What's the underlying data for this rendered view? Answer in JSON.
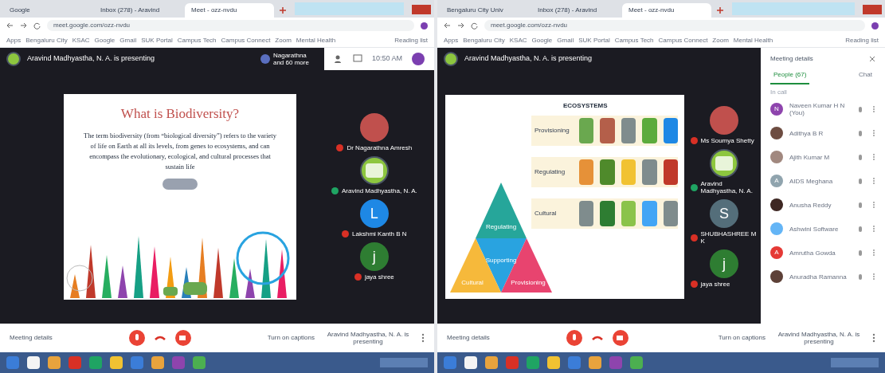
{
  "windows": [
    {
      "tabs": [
        {
          "label": "Google",
          "selected": false
        },
        {
          "label": "Inbox (278) - Aravind",
          "selected": false
        },
        {
          "label": "Meet - ozz-nvdu",
          "selected": true
        }
      ],
      "address": "meet.google.com/ozz-nvdu",
      "bookmarks": [
        "Apps",
        "Bengaluru City",
        "KSAC",
        "Google",
        "Gmail",
        "SUK Portal",
        "Campus Tech",
        "Campus Connect",
        "Zoom",
        "Mental Health"
      ],
      "reading_list": "Reading list",
      "presenting": "Aravind Madhyastha, N. A. is presenting",
      "presenter_chip": "Nagarathna and 60 more",
      "time": "10:50 AM",
      "slide": {
        "kind": "text",
        "title": "What is Biodiversity?",
        "body": "The term biodiversity (from “biological diversity”) refers to the variety of life on Earth at all its levels, from genes to ecosystems, and can encompass the evolutionary, ecological, and cultural processes that sustain life"
      },
      "participants": [
        {
          "name": "Dr Nagarathna Amresh",
          "kind": "photo",
          "color": "#c0504d",
          "muted": true
        },
        {
          "name": "Aravind Madhyastha, N. A.",
          "kind": "logo",
          "color": "#8dc63f",
          "muted": false
        },
        {
          "name": "Lakshmi Kanth B N",
          "kind": "letter",
          "letter": "L",
          "color": "#1e88e5",
          "muted": true
        },
        {
          "name": "jaya shree",
          "kind": "letter",
          "letter": "j",
          "color": "#2e7d32",
          "muted": true
        }
      ],
      "bottom": {
        "details": "Meeting details",
        "captions": "Turn on captions",
        "presenter": "Aravind Madhyastha, N. A. is presenting"
      }
    },
    {
      "tabs": [
        {
          "label": "Bengaluru City Univ",
          "selected": false
        },
        {
          "label": "Inbox (278) - Aravind",
          "selected": false
        },
        {
          "label": "Meet - ozz-nvdu",
          "selected": true
        }
      ],
      "address": "meet.google.com/ozz-nvdu",
      "bookmarks": [
        "Apps",
        "Bengaluru City",
        "KSAC",
        "Google",
        "Gmail",
        "SUK Portal",
        "Campus Tech",
        "Campus Connect",
        "Zoom",
        "Mental Health"
      ],
      "reading_list": "Reading list",
      "presenting": "Aravind Madhyastha, N. A. is presenting",
      "slide": {
        "kind": "ecosystem",
        "title": "ECOSYSTEMS",
        "rows": [
          {
            "label": "Provisioning",
            "icons": [
              {
                "color": "#6aa84f"
              },
              {
                "color": "#b45f4a"
              },
              {
                "color": "#7f8c8d"
              },
              {
                "color": "#5cab3c"
              },
              {
                "color": "#1e88e5"
              }
            ]
          },
          {
            "label": "Regulating",
            "icons": [
              {
                "color": "#e69138"
              },
              {
                "color": "#4f8a2b"
              },
              {
                "color": "#f1c232"
              },
              {
                "color": "#7f8c8d"
              },
              {
                "color": "#c0392b"
              }
            ]
          },
          {
            "label": "Cultural",
            "icons": [
              {
                "color": "#7f8c8d"
              },
              {
                "color": "#2e7d32"
              },
              {
                "color": "#8bc34a"
              },
              {
                "color": "#42a5f5"
              },
              {
                "color": "#7f8c8d"
              }
            ]
          }
        ],
        "pyramid": [
          {
            "label": "Regulating",
            "color": "#26a69a"
          },
          {
            "label": "Supporting",
            "color": "#29a3e0"
          },
          {
            "label": "Cultural",
            "color": "#f6b93b"
          },
          {
            "label": "Provisioning",
            "color": "#e8446f"
          }
        ]
      },
      "participants": [
        {
          "name": "Ms Soumya Shetty",
          "kind": "photo",
          "color": "#c0504d",
          "muted": true
        },
        {
          "name": "Aravind Madhyastha, N. A.",
          "kind": "logo",
          "color": "#8dc63f",
          "muted": false
        },
        {
          "name": "SHUBHASHREE M K",
          "kind": "letter",
          "letter": "S",
          "color": "#546e7a",
          "muted": true
        },
        {
          "name": "jaya shree",
          "kind": "letter",
          "letter": "j",
          "color": "#2e7d32",
          "muted": true
        }
      ],
      "side_panel": {
        "title": "Meeting details",
        "tabs": [
          {
            "label": "People (67)",
            "selected": true
          },
          {
            "label": "Chat",
            "selected": false
          }
        ],
        "section": "In call",
        "people": [
          {
            "name": "Naveen Kumar H N (You)",
            "kind": "letter",
            "letter": "N",
            "color": "#8e44ad"
          },
          {
            "name": "Adithya B R",
            "kind": "photo",
            "color": "#6d4c41"
          },
          {
            "name": "Ajith Kumar M",
            "kind": "photo",
            "color": "#a1887f"
          },
          {
            "name": "AIDS Meghana",
            "kind": "letter",
            "letter": "A",
            "color": "#90a4ae"
          },
          {
            "name": "Anusha Reddy",
            "kind": "photo",
            "color": "#3e2723"
          },
          {
            "name": "Ashwini Software",
            "kind": "photo",
            "color": "#64b5f6"
          },
          {
            "name": "Amrutha Gowda",
            "kind": "letter",
            "letter": "A",
            "color": "#e53935"
          },
          {
            "name": "Anuradha Ramanna",
            "kind": "photo",
            "color": "#5d4037"
          }
        ]
      },
      "bottom": {
        "details": "Meeting details",
        "captions": "Turn on captions",
        "presenter": "Aravind Madhyastha, N. A. is presenting"
      }
    }
  ]
}
